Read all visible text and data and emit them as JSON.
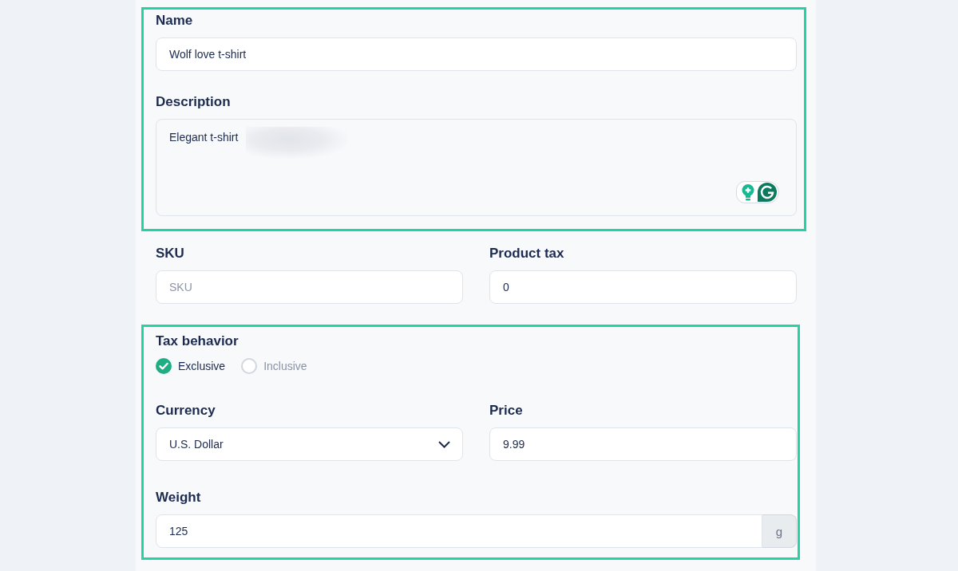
{
  "groups": [
    {
      "highlighted": true,
      "rows": [
        [
          {
            "kind": "text",
            "label": "Name",
            "value": "Wolf love t-shirt"
          }
        ],
        [
          {
            "kind": "textarea",
            "label": "Description",
            "value": "Elegant t-shirt",
            "redacted": true
          }
        ]
      ]
    },
    {
      "highlighted": false,
      "rows": [
        [
          {
            "kind": "text",
            "label": "SKU",
            "placeholder": "SKU"
          },
          {
            "kind": "text",
            "label": "Product tax",
            "value": "0"
          }
        ]
      ]
    },
    {
      "highlighted": true,
      "rows": [
        [
          {
            "kind": "radio",
            "label": "Tax behavior",
            "options": [
              {
                "label": "Exclusive",
                "selected": true
              },
              {
                "label": "Inclusive",
                "selected": false
              }
            ]
          }
        ],
        [
          {
            "kind": "select",
            "label": "Currency",
            "value": "U.S. Dollar"
          },
          {
            "kind": "text",
            "label": "Price",
            "value": "9.99"
          }
        ],
        [
          {
            "kind": "text",
            "label": "Weight",
            "value": "125",
            "suffix": "g"
          }
        ]
      ]
    }
  ]
}
